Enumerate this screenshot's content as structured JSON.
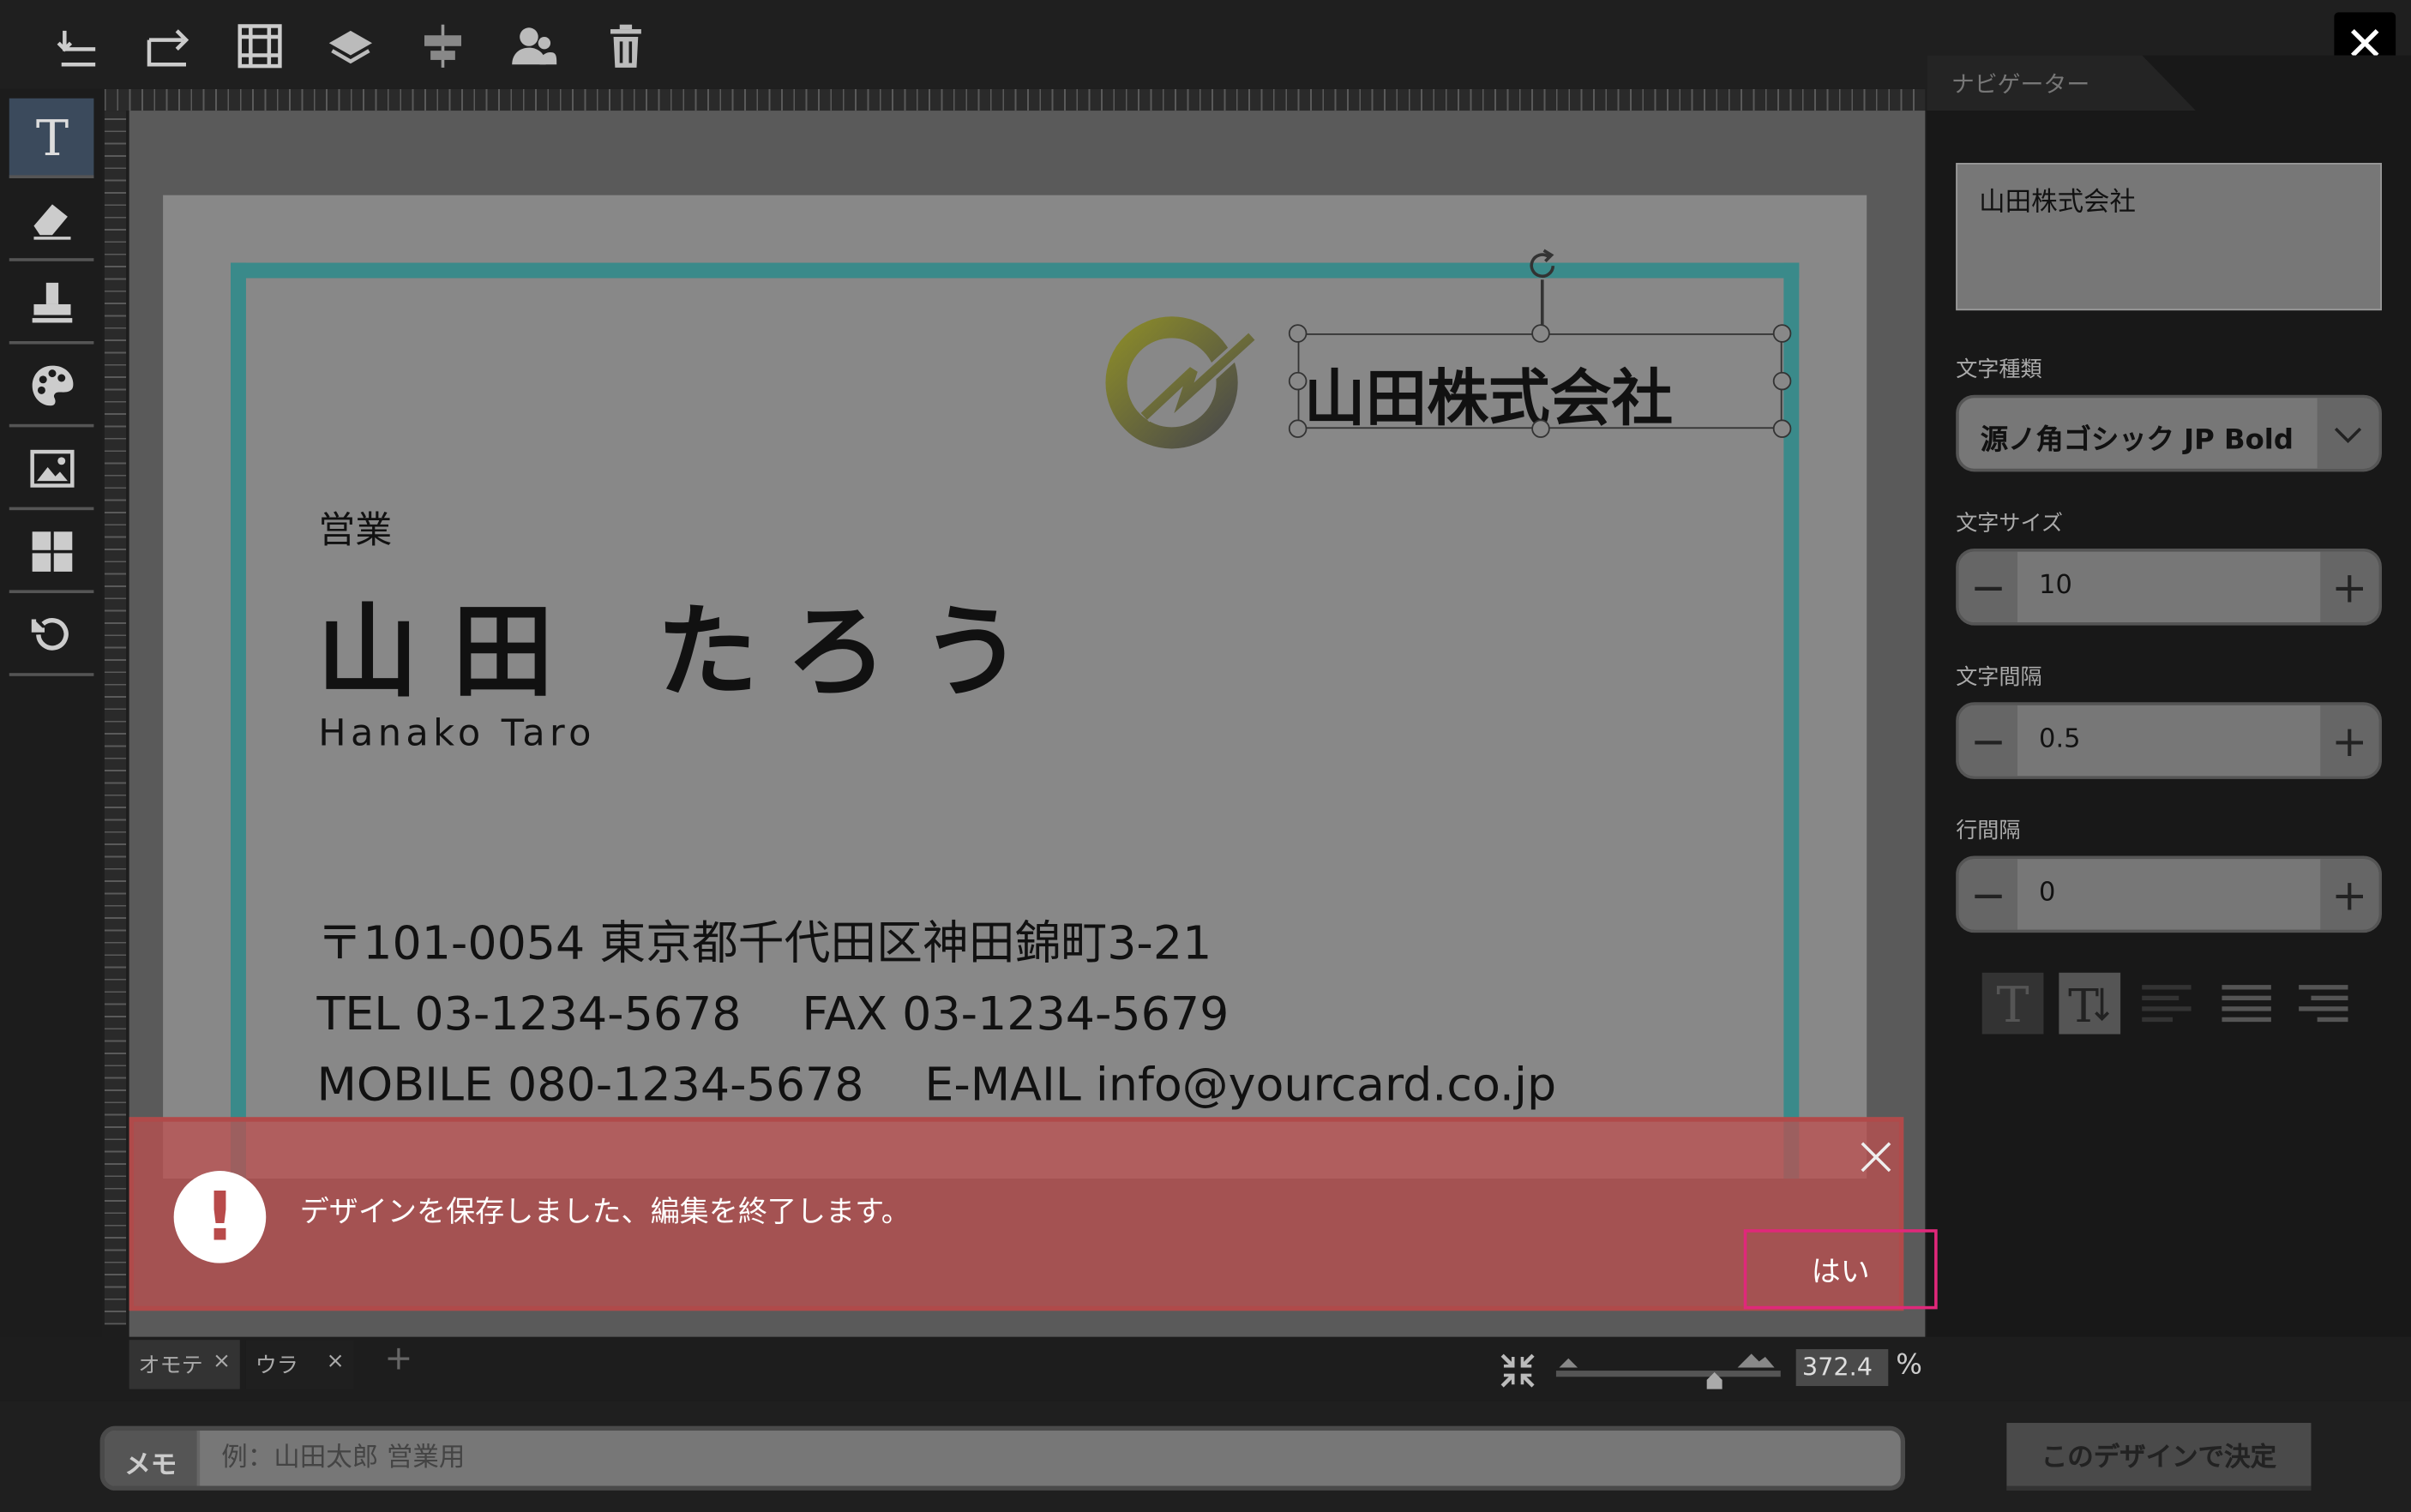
{
  "navigator": {
    "tab_title": "ナビゲーター",
    "text_value": "山田株式会社",
    "font_type_label": "文字種類",
    "font_type_value": "源ノ角ゴシック JP Bold",
    "font_size_label": "文字サイズ",
    "font_size_value": "10",
    "letter_spacing_label": "文字間隔",
    "letter_spacing_value": "0.5",
    "line_spacing_label": "行間隔",
    "line_spacing_value": "0"
  },
  "card": {
    "company": "山田株式会社",
    "department": "営業",
    "name": "山田 たろう",
    "name_roman": "Hanako Taro",
    "address": "〒101-0054 東京都千代田区神田錦町3-21",
    "tel_fax": "TEL 03-1234-5678　 FAX 03-1234-5679",
    "mobile_email": "MOBILE 080-1234-5678　 E-MAIL info@yourcard.co.jp"
  },
  "alert": {
    "message": "デザインを保存しました、編集を終了します。",
    "yes_label": "はい"
  },
  "pages": {
    "front": "オモテ",
    "back": "ウラ",
    "add": "+"
  },
  "zoom": {
    "value": "372.4",
    "unit": "%"
  },
  "footer": {
    "memo_label": "メモ",
    "memo_placeholder": "例：山田太郎 営業用",
    "decide_label": "このデザインで決定"
  },
  "colors": {
    "accent_border": "#3a8a8a",
    "alert_bg": "#be5050",
    "highlight": "#e0287a"
  }
}
